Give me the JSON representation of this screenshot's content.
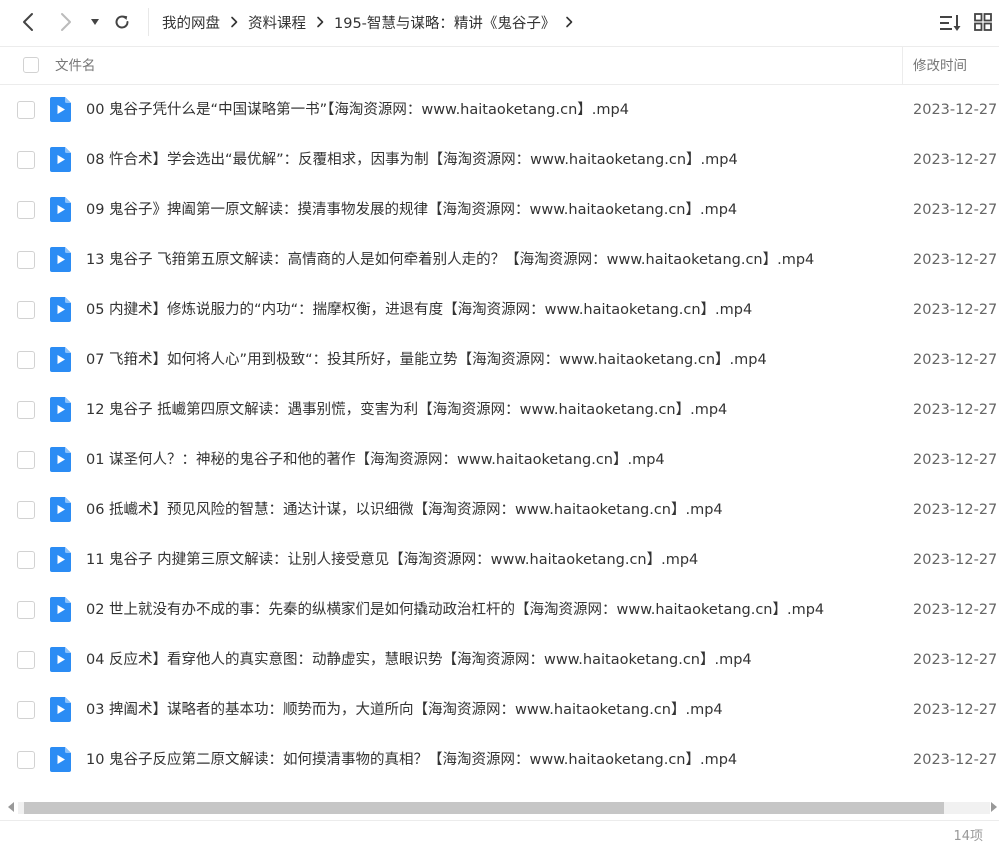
{
  "toolbar": {
    "breadcrumbs": [
      "我的网盘",
      "资料课程",
      "195-智慧与谋略：精讲《鬼谷子》"
    ]
  },
  "columns": {
    "name": "文件名",
    "modified": "修改时间"
  },
  "files": [
    {
      "name": "00 鬼谷子凭什么是“中国谋略第一书”【海淘资源网：www.haitaoketang.cn】.mp4",
      "date": "2023-12-27"
    },
    {
      "name": "08 忤合术】学会选出“最优解”：反覆相求，因事为制【海淘资源网：www.haitaoketang.cn】.mp4",
      "date": "2023-12-27"
    },
    {
      "name": "09 鬼谷子》捭阖第一原文解读：摸清事物发展的规律【海淘资源网：www.haitaoketang.cn】.mp4",
      "date": "2023-12-27"
    },
    {
      "name": "13 鬼谷子 飞箝第五原文解读：高情商的人是如何牵着别人走的？【海淘资源网：www.haitaoketang.cn】.mp4",
      "date": "2023-12-27"
    },
    {
      "name": "05 内揵术】修炼说服力的“内功“：揣摩权衡，进退有度【海淘资源网：www.haitaoketang.cn】.mp4",
      "date": "2023-12-27"
    },
    {
      "name": "07 飞箝术】如何将人心”用到极致“：投其所好，量能立势【海淘资源网：www.haitaoketang.cn】.mp4",
      "date": "2023-12-27"
    },
    {
      "name": "12 鬼谷子 抵巇第四原文解读：遇事别慌，变害为利【海淘资源网：www.haitaoketang.cn】.mp4",
      "date": "2023-12-27"
    },
    {
      "name": "01 谋圣何人？：神秘的鬼谷子和他的著作【海淘资源网：www.haitaoketang.cn】.mp4",
      "date": "2023-12-27"
    },
    {
      "name": "06 抵巇术】预见风险的智慧：通达计谋，以识细微【海淘资源网：www.haitaoketang.cn】.mp4",
      "date": "2023-12-27"
    },
    {
      "name": "11 鬼谷子 内揵第三原文解读：让别人接受意见【海淘资源网：www.haitaoketang.cn】.mp4",
      "date": "2023-12-27"
    },
    {
      "name": "02 世上就没有办不成的事：先秦的纵横家们是如何撬动政治杠杆的【海淘资源网：www.haitaoketang.cn】.mp4",
      "date": "2023-12-27"
    },
    {
      "name": "04 反应术】看穿他人的真实意图：动静虚实，慧眼识势【海淘资源网：www.haitaoketang.cn】.mp4",
      "date": "2023-12-27"
    },
    {
      "name": "03 捭阖术】谋略者的基本功：顺势而为，大道所向【海淘资源网：www.haitaoketang.cn】.mp4",
      "date": "2023-12-27"
    },
    {
      "name": "10 鬼谷子反应第二原文解读：如何摸清事物的真相？【海淘资源网：www.haitaoketang.cn】.mp4",
      "date": "2023-12-27"
    }
  ],
  "footer": {
    "count": "14项"
  },
  "colors": {
    "video_icon": "#2b8cf4",
    "video_icon_fold": "#8cc2fb"
  },
  "icons": {
    "back": "chevron-left-icon",
    "forward": "chevron-right-icon",
    "dropdown": "caret-down-icon",
    "refresh": "refresh-icon",
    "sort": "sort-icon",
    "view": "grid-view-icon",
    "file": "video-file-icon"
  }
}
